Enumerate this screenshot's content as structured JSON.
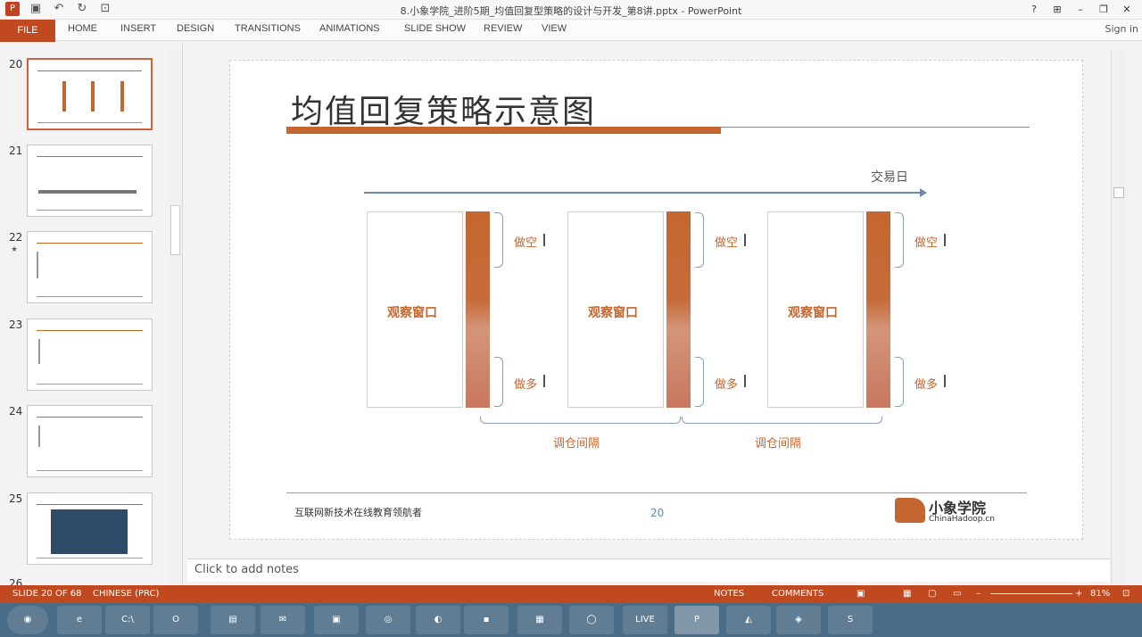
{
  "window": {
    "title": "8.小象学院_进阶5期_均值回复型策略的设计与开发_第8讲.pptx - PowerPoint"
  },
  "ribbon": {
    "file": "FILE",
    "tabs": [
      "HOME",
      "INSERT",
      "DESIGN",
      "TRANSITIONS",
      "ANIMATIONS",
      "SLIDE SHOW",
      "REVIEW",
      "VIEW"
    ],
    "signin": "Sign in"
  },
  "thumbnails": [
    {
      "num": "20",
      "selected": true
    },
    {
      "num": "21"
    },
    {
      "num": "22",
      "star": "★"
    },
    {
      "num": "23"
    },
    {
      "num": "24"
    },
    {
      "num": "25"
    },
    {
      "num": "26"
    }
  ],
  "slide": {
    "title": "均值回复策略示意图",
    "axis_label": "交易日",
    "window_label": "观察窗口",
    "short_label": "做空",
    "long_label": "做多",
    "interval_label": "调仓间隔",
    "footer_text": "互联网新技术在线教育领航者",
    "slide_number": "20",
    "brand_name": "小象学院",
    "brand_url": "ChinaHadoop.cn",
    "accent": "#c4662f"
  },
  "notes": {
    "placeholder": "Click to add notes"
  },
  "status": {
    "slide_info": "SLIDE 20 OF 68",
    "language": "CHINESE (PRC)",
    "notes_btn": "NOTES",
    "comments_btn": "COMMENTS",
    "zoom": "81%"
  },
  "taskbar": [
    "start",
    "ie",
    "cmd",
    "ol",
    "explorer",
    "mail",
    "terminal",
    "chrome",
    "elephant",
    "app",
    "calc",
    "wechat",
    "live",
    "ppt",
    "unity",
    "python",
    "s"
  ]
}
